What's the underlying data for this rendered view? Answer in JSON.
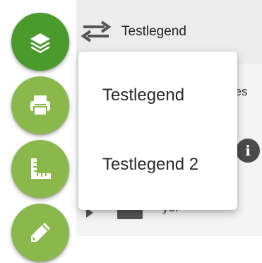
{
  "rail": {
    "buttons": [
      {
        "name": "layers",
        "icon": "layers-icon",
        "active": true
      },
      {
        "name": "print",
        "icon": "printer-icon",
        "active": false
      },
      {
        "name": "measure",
        "icon": "ruler-square-icon",
        "active": false
      },
      {
        "name": "draw",
        "icon": "pencil-icon",
        "active": false
      }
    ],
    "colors": {
      "active": "#4a9a2c",
      "inactive": "#8ab84a"
    }
  },
  "panel": {
    "title": "Testlegend",
    "swap_icon": "swap-horizontal-icon",
    "partial_row_services": "ces",
    "info_icon": "info-icon",
    "info_glyph": "i",
    "partial_row_layer": "yer"
  },
  "menu": {
    "items": [
      {
        "label": "Testlegend"
      },
      {
        "label": "Testlegend 2"
      }
    ]
  }
}
